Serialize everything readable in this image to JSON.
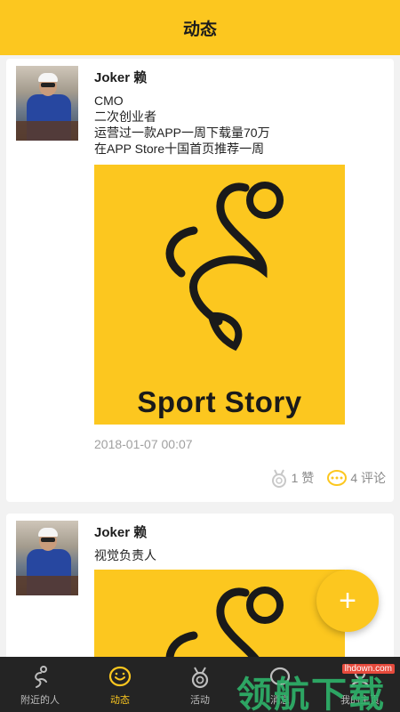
{
  "header": {
    "title": "动态"
  },
  "posts": [
    {
      "author": "Joker 赖",
      "bio_lines": [
        "CMO",
        "二次创业者",
        "运营过一款APP一周下载量70万",
        "在APP Store十国首页推荐一周"
      ],
      "image_text": "Sport Story",
      "time": "2018-01-07 00:07",
      "likes": "1 赞",
      "comments": "4 评论"
    },
    {
      "author": "Joker 赖",
      "bio_lines": [
        "视觉负责人"
      ]
    }
  ],
  "fab": {
    "label": "+"
  },
  "tabbar": {
    "items": [
      {
        "label": "附近的人",
        "icon": "runner-icon"
      },
      {
        "label": "动态",
        "icon": "smile-bubble-icon"
      },
      {
        "label": "活动",
        "icon": "medal-icon"
      },
      {
        "label": "消息",
        "icon": "message-icon"
      },
      {
        "label": "我的主页",
        "icon": "profile-icon"
      }
    ]
  },
  "watermark": {
    "site": "lhdown.com",
    "text": "领航下载"
  },
  "colors": {
    "accent": "#fcc71f",
    "tabbar": "#242424",
    "watermark": "#2fb36a"
  }
}
